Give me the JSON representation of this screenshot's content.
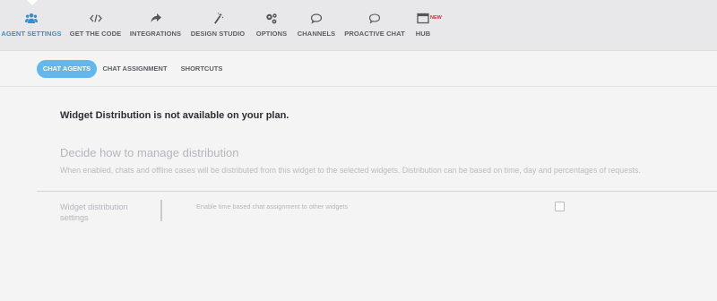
{
  "nav": {
    "items": [
      {
        "label": "AGENT SETTINGS",
        "icon": "users-icon"
      },
      {
        "label": "GET THE CODE",
        "icon": "code-icon"
      },
      {
        "label": "INTEGRATIONS",
        "icon": "share-arrow-icon"
      },
      {
        "label": "DESIGN STUDIO",
        "icon": "magic-wand-icon"
      },
      {
        "label": "OPTIONS",
        "icon": "gears-icon"
      },
      {
        "label": "CHANNELS",
        "icon": "chat-bubble-icon"
      },
      {
        "label": "PROACTIVE CHAT",
        "icon": "chat-bubble-outline-icon"
      },
      {
        "label": "HUB",
        "icon": "browser-window-icon",
        "badge": "NEW"
      }
    ],
    "active_color": "#3f8ec8",
    "badge_color": "#d9262b"
  },
  "subtabs": [
    {
      "label": "CHAT AGENTS",
      "active": true
    },
    {
      "label": "CHAT ASSIGNMENT",
      "active": false
    },
    {
      "label": "SHORTCUTS",
      "active": false
    }
  ],
  "subtab_active_color": "#62b7ec",
  "notice": "Widget Distribution is not available on your plan.",
  "section": {
    "title": "Decide how to manage distribution",
    "description": "When enabled, chats and offline cases will be distributed from this widget to the selected widgets. Distribution can be based on time, day and percentages of requests."
  },
  "settings": {
    "label_line1": "Widget distribution",
    "label_line2": "settings",
    "option_text": "Enable time based chat assignment to other widgets",
    "checked": false
  }
}
